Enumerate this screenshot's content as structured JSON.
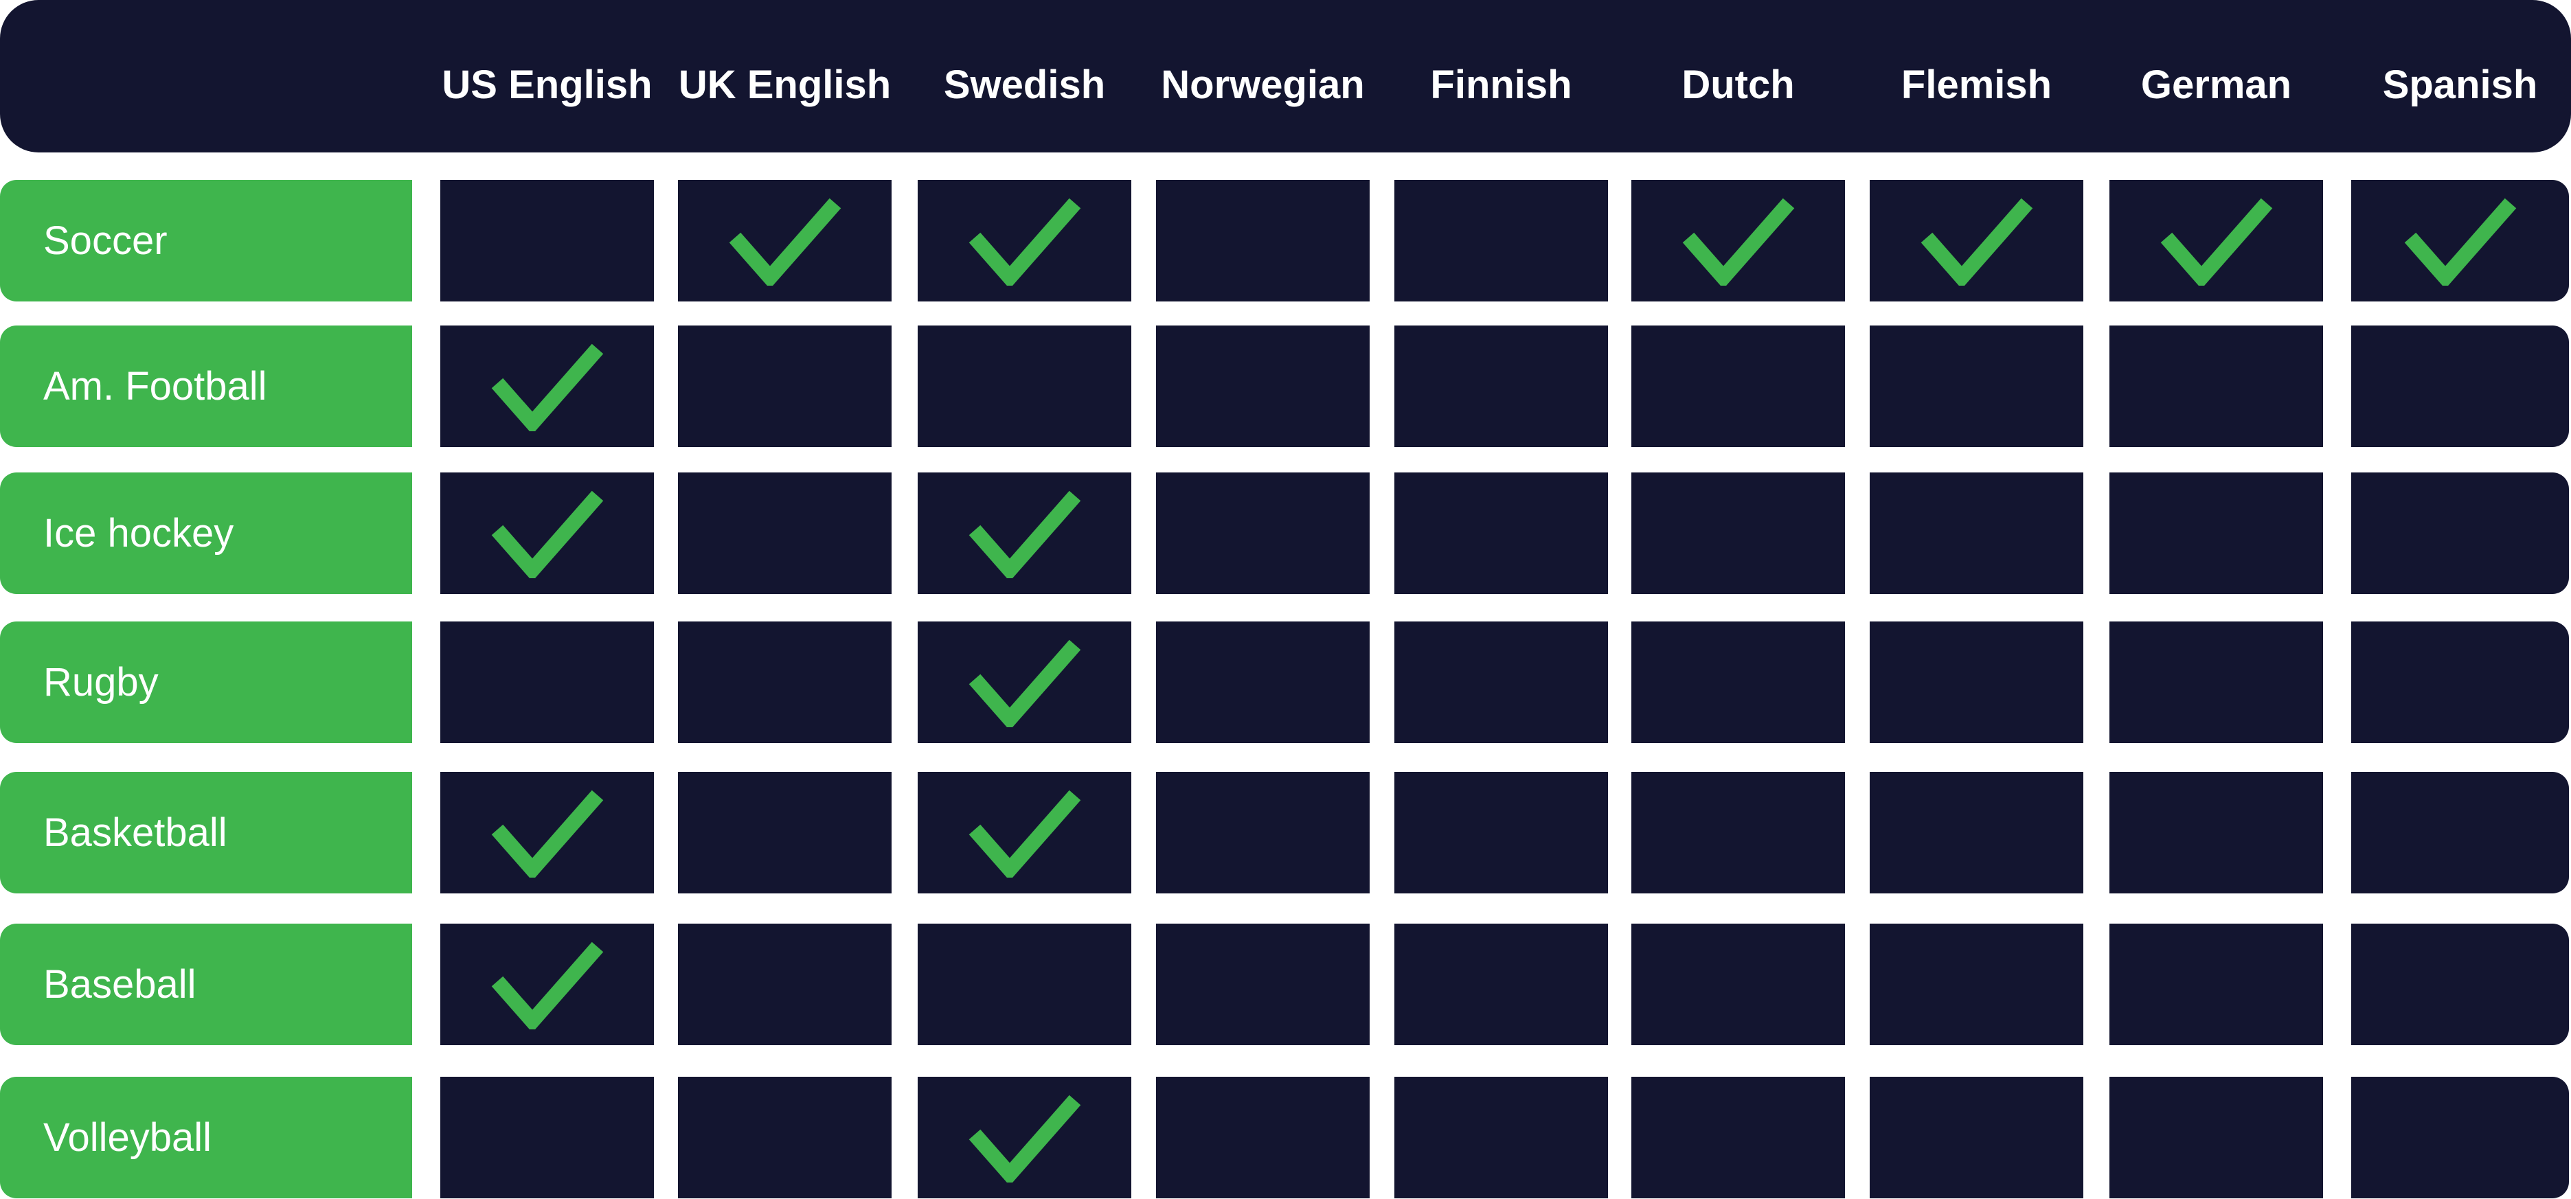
{
  "chart_data": {
    "type": "table",
    "title": "",
    "columns": [
      "US English",
      "UK English",
      "Swedish",
      "Norwegian",
      "Finnish",
      "Dutch",
      "Flemish",
      "German",
      "Spanish"
    ],
    "rows": [
      {
        "label": "Soccer",
        "values": [
          false,
          true,
          true,
          false,
          false,
          true,
          true,
          true,
          true
        ]
      },
      {
        "label": "Am. Football",
        "values": [
          true,
          false,
          false,
          false,
          false,
          false,
          false,
          false,
          false
        ]
      },
      {
        "label": "Ice hockey",
        "values": [
          true,
          false,
          true,
          false,
          false,
          false,
          false,
          false,
          false
        ]
      },
      {
        "label": "Rugby",
        "values": [
          false,
          false,
          true,
          false,
          false,
          false,
          false,
          false,
          false
        ]
      },
      {
        "label": "Basketball",
        "values": [
          true,
          false,
          true,
          false,
          false,
          false,
          false,
          false,
          false
        ]
      },
      {
        "label": "Baseball",
        "values": [
          true,
          false,
          false,
          false,
          false,
          false,
          false,
          false,
          false
        ]
      },
      {
        "label": "Volleyball",
        "values": [
          false,
          false,
          true,
          false,
          false,
          false,
          false,
          false,
          false
        ]
      }
    ],
    "check_icon": "checkmark-icon"
  },
  "colors": {
    "navy": "#131530",
    "green": "#3FB54D",
    "text": "#ffffff",
    "background": "#ffffff"
  }
}
